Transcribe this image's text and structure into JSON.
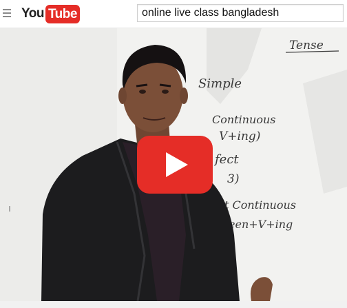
{
  "header": {
    "logo_you": "You",
    "logo_tube": "Tube",
    "menu_icon": "hamburger-menu-icon"
  },
  "search": {
    "query": "online live class bangladesh"
  },
  "video": {
    "whiteboard_lines": [
      "Tense",
      "Simple",
      "Continuous",
      "V+ing)",
      "fect",
      "3)",
      "t Continuous",
      "een+V+ing"
    ],
    "play_icon": "play-icon",
    "colors": {
      "play_red": "#e52d27",
      "brand_red": "#e52d27"
    }
  }
}
